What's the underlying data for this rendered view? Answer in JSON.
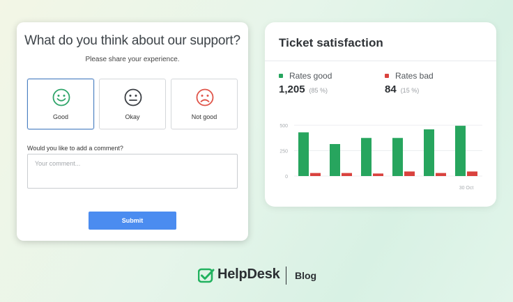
{
  "survey": {
    "title": "What do you think about our support?",
    "subtitle": "Please share your experience.",
    "options": [
      {
        "label": "Good",
        "icon": "smiley-happy-icon",
        "color": "#2fa56a",
        "selected": true
      },
      {
        "label": "Okay",
        "icon": "smiley-neutral-icon",
        "color": "#3b3f44",
        "selected": false
      },
      {
        "label": "Not good",
        "icon": "smiley-sad-icon",
        "color": "#e0554a",
        "selected": false
      }
    ],
    "comment_label": "Would you like to add a comment?",
    "comment_placeholder": "Your comment...",
    "submit_label": "Submit",
    "submit_color": "#4b8cf0"
  },
  "satisfaction": {
    "title": "Ticket satisfaction",
    "good": {
      "label": "Rates good",
      "value": "1,205",
      "percent": "(85 %)",
      "color": "#27a55e"
    },
    "bad": {
      "label": "Rates bad",
      "value": "84",
      "percent": "(15 %)",
      "color": "#d9423e"
    }
  },
  "chart_data": {
    "type": "bar",
    "categories": [
      "",
      "",
      "",
      "",
      "",
      "30 Oct"
    ],
    "series": [
      {
        "name": "Rates good",
        "color": "#27a55e",
        "values": [
          430,
          315,
          375,
          375,
          460,
          495
        ]
      },
      {
        "name": "Rates bad",
        "color": "#d9423e",
        "values": [
          30,
          30,
          25,
          45,
          30,
          45
        ]
      }
    ],
    "y_ticks": [
      "500",
      "250",
      "0"
    ],
    "x_tick_labels": [
      "30 Oct"
    ],
    "ylim": [
      0,
      500
    ],
    "grid": true
  },
  "footer": {
    "brand": "HelpDesk",
    "link": "Blog",
    "brand_color": "#22b25f"
  }
}
